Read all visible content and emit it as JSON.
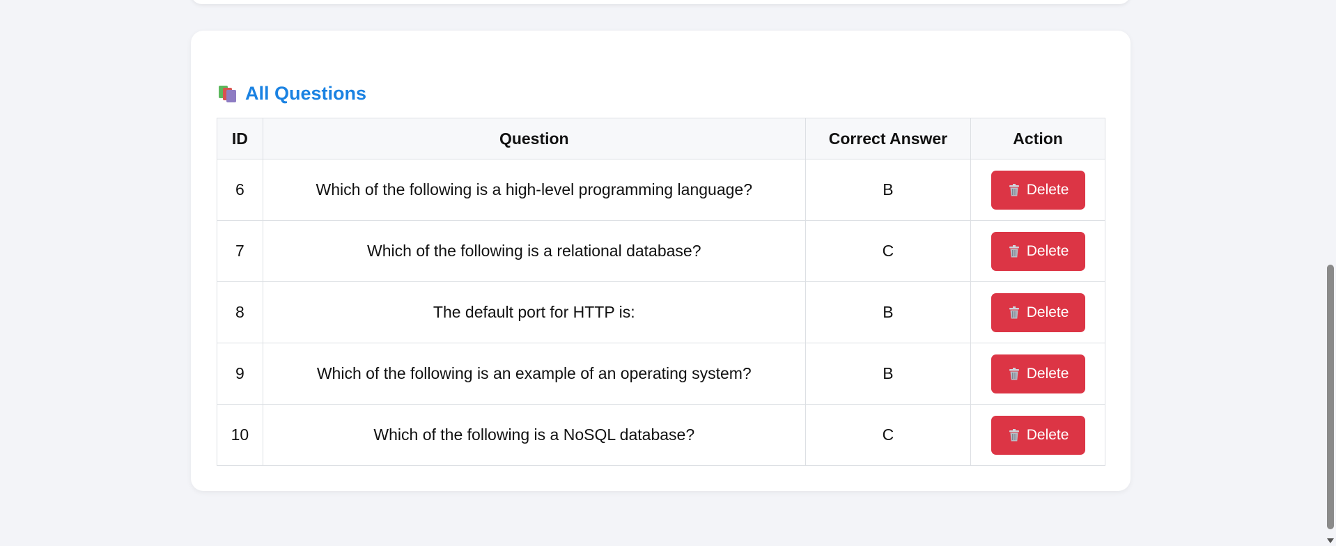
{
  "section": {
    "title": "All Questions",
    "icon": "books-icon"
  },
  "table": {
    "headers": [
      "ID",
      "Question",
      "Correct Answer",
      "Action"
    ],
    "rows": [
      {
        "id": "6",
        "question": "Which of the following is a high-level programming language?",
        "answer": "B",
        "action": "Delete"
      },
      {
        "id": "7",
        "question": "Which of the following is a relational database?",
        "answer": "C",
        "action": "Delete"
      },
      {
        "id": "8",
        "question": "The default port for HTTP is:",
        "answer": "B",
        "action": "Delete"
      },
      {
        "id": "9",
        "question": "Which of the following is an example of an operating system?",
        "answer": "B",
        "action": "Delete"
      },
      {
        "id": "10",
        "question": "Which of the following is a NoSQL database?",
        "answer": "C",
        "action": "Delete"
      }
    ]
  },
  "colors": {
    "accent": "#1a82e2",
    "danger": "#dc3545",
    "background": "#f3f4f8"
  }
}
